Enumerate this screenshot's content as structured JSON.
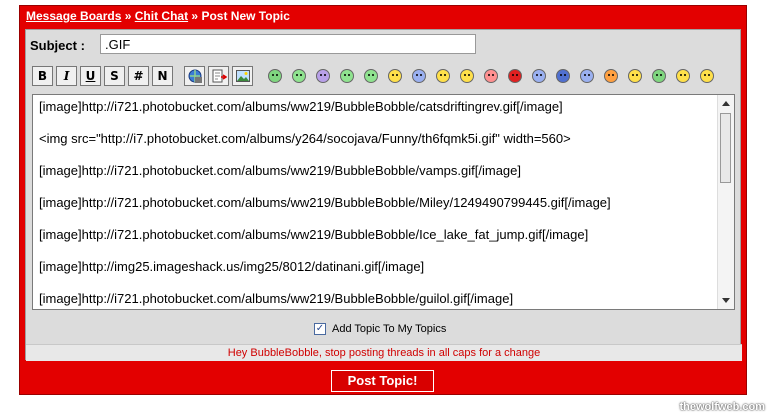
{
  "breadcrumb": {
    "message_boards": "Message Boards",
    "sep1": "»",
    "chit_chat": "Chit Chat",
    "sep2": "»",
    "current": "Post New Topic"
  },
  "subject": {
    "label": "Subject :",
    "value": ".GIF"
  },
  "toolbar": {
    "format_buttons": [
      "B",
      "I",
      "U",
      "S",
      "#",
      "N"
    ],
    "insert_icons": [
      "insert-link-icon",
      "insert-file-icon",
      "insert-image-icon"
    ],
    "smileys": [
      "grin",
      "smile",
      "surprised",
      "cool",
      "sunglasses",
      "wink",
      "frown",
      "smile-yellow",
      "laugh",
      "angry",
      "dizzy",
      "confused",
      "sad",
      "tongue",
      "happy-green",
      "sleepy",
      "big-grin"
    ]
  },
  "message": {
    "lines": [
      "[image]http://i721.photobucket.com/albums/ww219/BubbleBobble/catsdriftingrev.gif[/image]",
      "<img src=\"http://i7.photobucket.com/albums/y264/socojava/Funny/th6fqmk5i.gif\" width=560>",
      "[image]http://i721.photobucket.com/albums/ww219/BubbleBobble/vamps.gif[/image]",
      "[image]http://i721.photobucket.com/albums/ww219/BubbleBobble/Miley/1249490799445.gif[/image]",
      "[image]http://i721.photobucket.com/albums/ww219/BubbleBobble/Ice_lake_fat_jump.gif[/image]",
      "[image]http://img25.imageshack.us/img25/8012/datinani.gif[/image]",
      "[image]http://i721.photobucket.com/albums/ww219/BubbleBobble/guilol.gif[/image]"
    ]
  },
  "add_topic": {
    "label": "Add Topic To My Topics",
    "checked": true
  },
  "notice": "Hey BubbleBobble, stop posting threads in all caps for a change",
  "post_button": "Post Topic!",
  "watermark": "thewolfweb.com",
  "colors": {
    "frame_red": "#e30000",
    "panel_gray": "#dcdcdc",
    "notice_red": "#d00000"
  }
}
